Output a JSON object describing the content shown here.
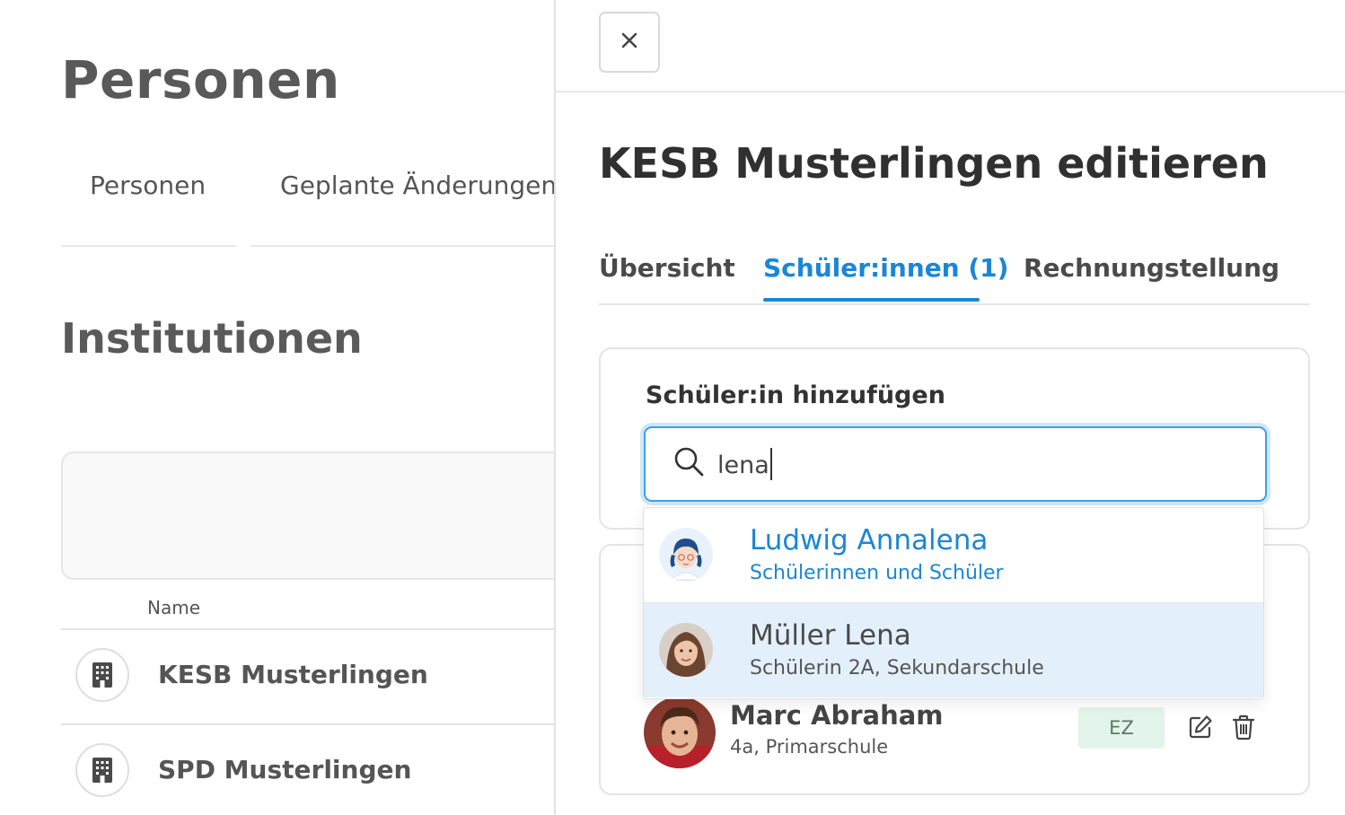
{
  "background_page": {
    "title": "Personen",
    "tabs": [
      {
        "label": "Personen"
      },
      {
        "label": "Geplante Änderungen"
      }
    ],
    "section_title": "Institutionen",
    "table": {
      "column_name": "Name",
      "rows": [
        {
          "name": "KESB Musterlingen",
          "icon": "building-icon"
        },
        {
          "name": "SPD Musterlingen",
          "icon": "building-icon"
        }
      ]
    }
  },
  "drawer": {
    "close_icon": "close-icon",
    "title": "KESB Musterlingen editieren",
    "tabs": [
      {
        "label": "Übersicht",
        "active": false
      },
      {
        "label": "Schüler:innen (1)",
        "active": true
      },
      {
        "label": "Rechnungstellung",
        "active": false
      }
    ],
    "add_student": {
      "label": "Schüler:in hinzufügen",
      "search_icon": "search-icon",
      "search_value": "lena"
    },
    "suggestions": [
      {
        "name": "Ludwig Annalena",
        "subtitle": "Schülerinnen und Schüler",
        "avatar": "illustrated-girl-avatar"
      },
      {
        "name": "Müller Lena",
        "subtitle": "Schülerin 2A, Sekundarschule",
        "avatar": "photo-avatar",
        "highlighted": true
      }
    ],
    "students": [
      {
        "name": "Marc Abraham",
        "subtitle": "4a, Primarschule",
        "badge": "EZ",
        "actions": [
          "edit-icon",
          "trash-icon"
        ]
      }
    ]
  },
  "colors": {
    "accent": "#1b86d6",
    "highlight_row": "#e3f0fb",
    "badge_bg": "#e3f4ea"
  }
}
